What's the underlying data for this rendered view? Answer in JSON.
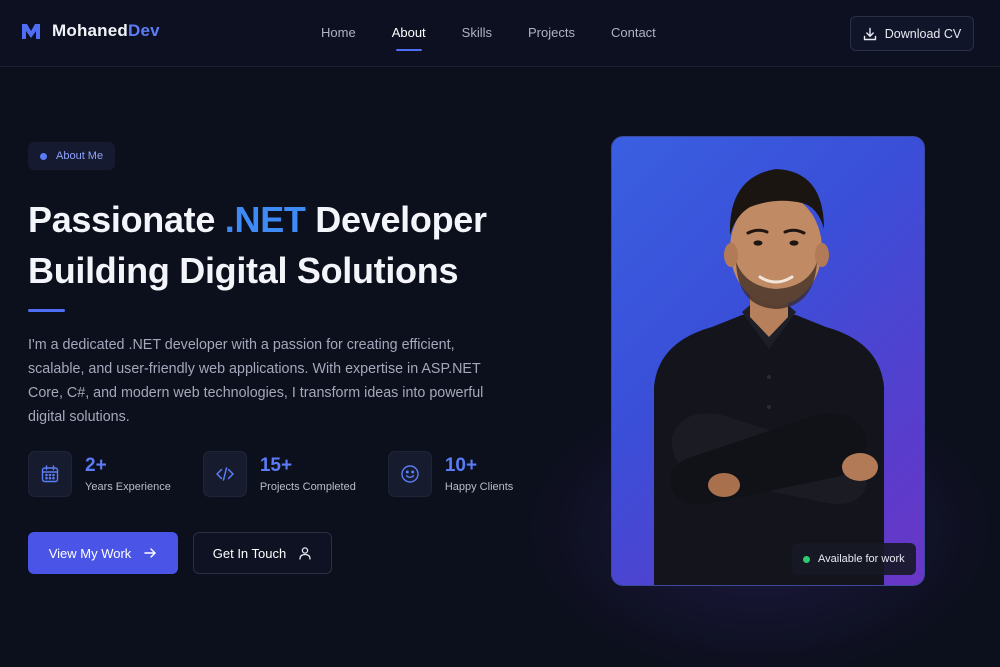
{
  "brand": {
    "name_primary": "Mohaned",
    "name_accent": "Dev",
    "accent_color": "#5b7cf6"
  },
  "nav": {
    "links": [
      {
        "label": "Home",
        "active": false
      },
      {
        "label": "About",
        "active": true
      },
      {
        "label": "Skills",
        "active": false
      },
      {
        "label": "Projects",
        "active": false
      },
      {
        "label": "Contact",
        "active": false
      }
    ],
    "download_label": "Download CV",
    "download_icon": "download-icon"
  },
  "hero": {
    "badge": "About Me",
    "headline_pre": "Passionate ",
    "headline_highlight": ".NET",
    "headline_post": " Developer",
    "headline_line2": "Building Digital Solutions",
    "intro": "I'm a dedicated .NET developer with a passion for creating efficient, scalable, and user-friendly web applications. With expertise in ASP.NET Core, C#, and modern web technologies, I transform ideas into powerful digital solutions.",
    "stats": [
      {
        "value": "2+",
        "label": "Years Experience",
        "icon": "calendar-icon"
      },
      {
        "value": "15+",
        "label": "Projects Completed",
        "icon": "code-icon"
      },
      {
        "value": "10+",
        "label": "Happy Clients",
        "icon": "smiley-icon"
      }
    ],
    "primary_button": "View My Work",
    "secondary_button": "Get In Touch"
  },
  "portrait": {
    "status": "Available for work",
    "status_color": "#2ecc71"
  },
  "colors": {
    "background": "#0c0f1c",
    "primary": "#4a55e8",
    "highlight": "#3f8bf6"
  }
}
